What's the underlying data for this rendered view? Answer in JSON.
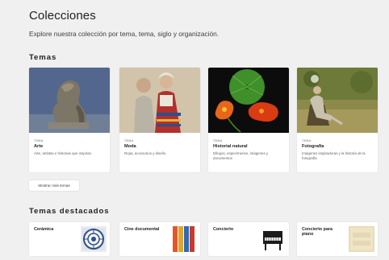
{
  "header": {
    "title": "Colecciones",
    "subtitle": "Explore nuestra colección por tema, tema, siglo y organización."
  },
  "themes_section": {
    "title": "Temas",
    "cards": [
      {
        "tag": "TEMA",
        "name": "Arte",
        "description": "Arte, artistas e historias que inspiran",
        "image": "bust-sculpture-photo"
      },
      {
        "tag": "TEMA",
        "name": "Moda",
        "description": "Ropa, accesorios y diseño",
        "image": "folk-costume-photo"
      },
      {
        "tag": "TEMA",
        "name": "Historial natural",
        "description": "Dibujos, especímenes, imágenes y documentos",
        "image": "nasturtium-flowers-photo"
      },
      {
        "tag": "TEMA",
        "name": "Fotografía",
        "description": "Imágenes inspiradoras y la historia de la fotografía",
        "image": "man-in-garden-chair-photo"
      }
    ],
    "more_button": "Mostrar más temas"
  },
  "featured_section": {
    "title": "Temas destacados",
    "cards": [
      {
        "name": "Cerámica",
        "image": "blue-plate-icon"
      },
      {
        "name": "Cine documental",
        "image": "color-film-strips-icon"
      },
      {
        "name": "Concierto",
        "image": "piano-icon"
      },
      {
        "name": "Concierto para piano",
        "image": "sheet-music-icon"
      }
    ]
  }
}
